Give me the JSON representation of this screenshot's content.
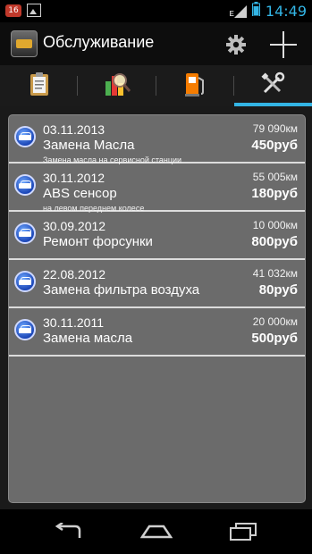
{
  "status_bar": {
    "notification_badge": "16",
    "time": "14:49",
    "network_type": "E",
    "accent_color": "#33b5e5"
  },
  "action_bar": {
    "title": "Обслуживание",
    "icons": [
      "car-app-icon",
      "gear-icon",
      "plus-icon"
    ]
  },
  "tabs": [
    {
      "icon": "clipboard-icon",
      "active": false
    },
    {
      "icon": "search-report-icon",
      "active": false
    },
    {
      "icon": "fuel-pump-icon",
      "active": false
    },
    {
      "icon": "tools-icon",
      "active": true
    }
  ],
  "records": [
    {
      "date": "03.11.2013",
      "title": "Замена Масла",
      "note": "Замена масла на сервисной станции",
      "mileage": "79 090км",
      "price": "450руб"
    },
    {
      "date": "30.11.2012",
      "title": "ABS сенсор",
      "note": "на левом переднем колесе",
      "mileage": "55 005км",
      "price": "180руб"
    },
    {
      "date": "30.09.2012",
      "title": "Ремонт форсунки",
      "note": "",
      "mileage": "10 000км",
      "price": "800руб"
    },
    {
      "date": "22.08.2012",
      "title": "Замена фильтра воздуха",
      "note": "",
      "mileage": "41 032км",
      "price": "80руб"
    },
    {
      "date": "30.11.2011",
      "title": "Замена масла",
      "note": "",
      "mileage": "20 000км",
      "price": "500руб"
    }
  ],
  "nav_bar": {
    "icons": [
      "back-icon",
      "home-icon",
      "recent-apps-icon"
    ]
  }
}
